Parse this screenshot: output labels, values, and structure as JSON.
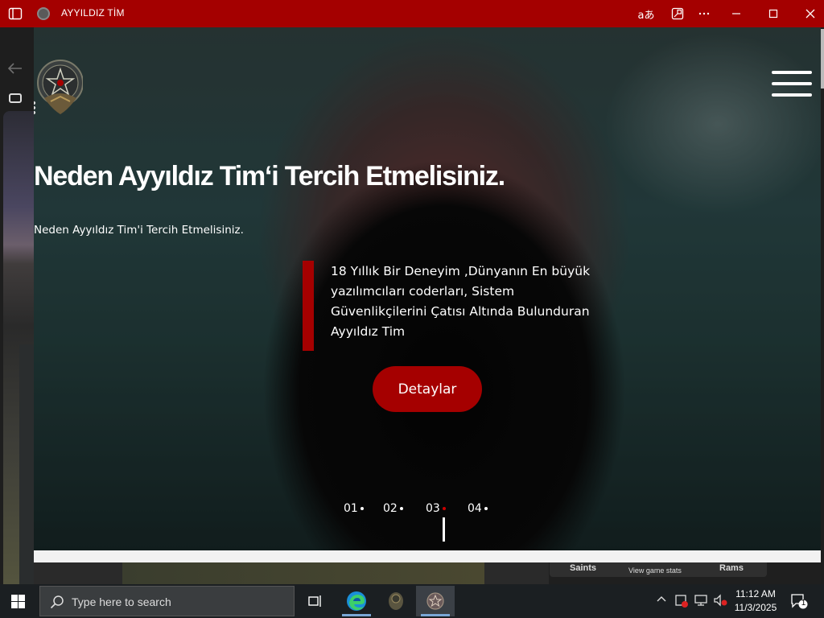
{
  "window": {
    "title": "AYYILDIZ TİM",
    "read_aloud_glyph": "aあ"
  },
  "page": {
    "hero_title": "Neden  Ayyıldız Tim‘i Tercih Etmelisiniz.",
    "hero_subtitle": "Neden Ayyıldız Tim'i Tercih Etmelisiniz.",
    "quote": "18 Yıllık Bir Deneyim ,Dünyanın En büyük yazılımcıları coderları, Sistem Güvenlikçilerini Çatısı Altında Bulunduran Ayyıldız Tim",
    "details_button": "Detaylar",
    "pagination": [
      {
        "label": "01",
        "active": false
      },
      {
        "label": "02",
        "active": false
      },
      {
        "label": "03",
        "active": true
      },
      {
        "label": "04",
        "active": false
      }
    ]
  },
  "background_window": {
    "team_left": "Saints",
    "stats_link": "View game stats",
    "team_right": "Rams"
  },
  "taskbar": {
    "search_placeholder": "Type here to search",
    "time": "11:12 AM",
    "date": "11/3/2025",
    "notification_count": "1"
  },
  "colors": {
    "accent_red": "#a50000",
    "titlebar": "#a40000",
    "taskbar": "#1b1f22"
  }
}
